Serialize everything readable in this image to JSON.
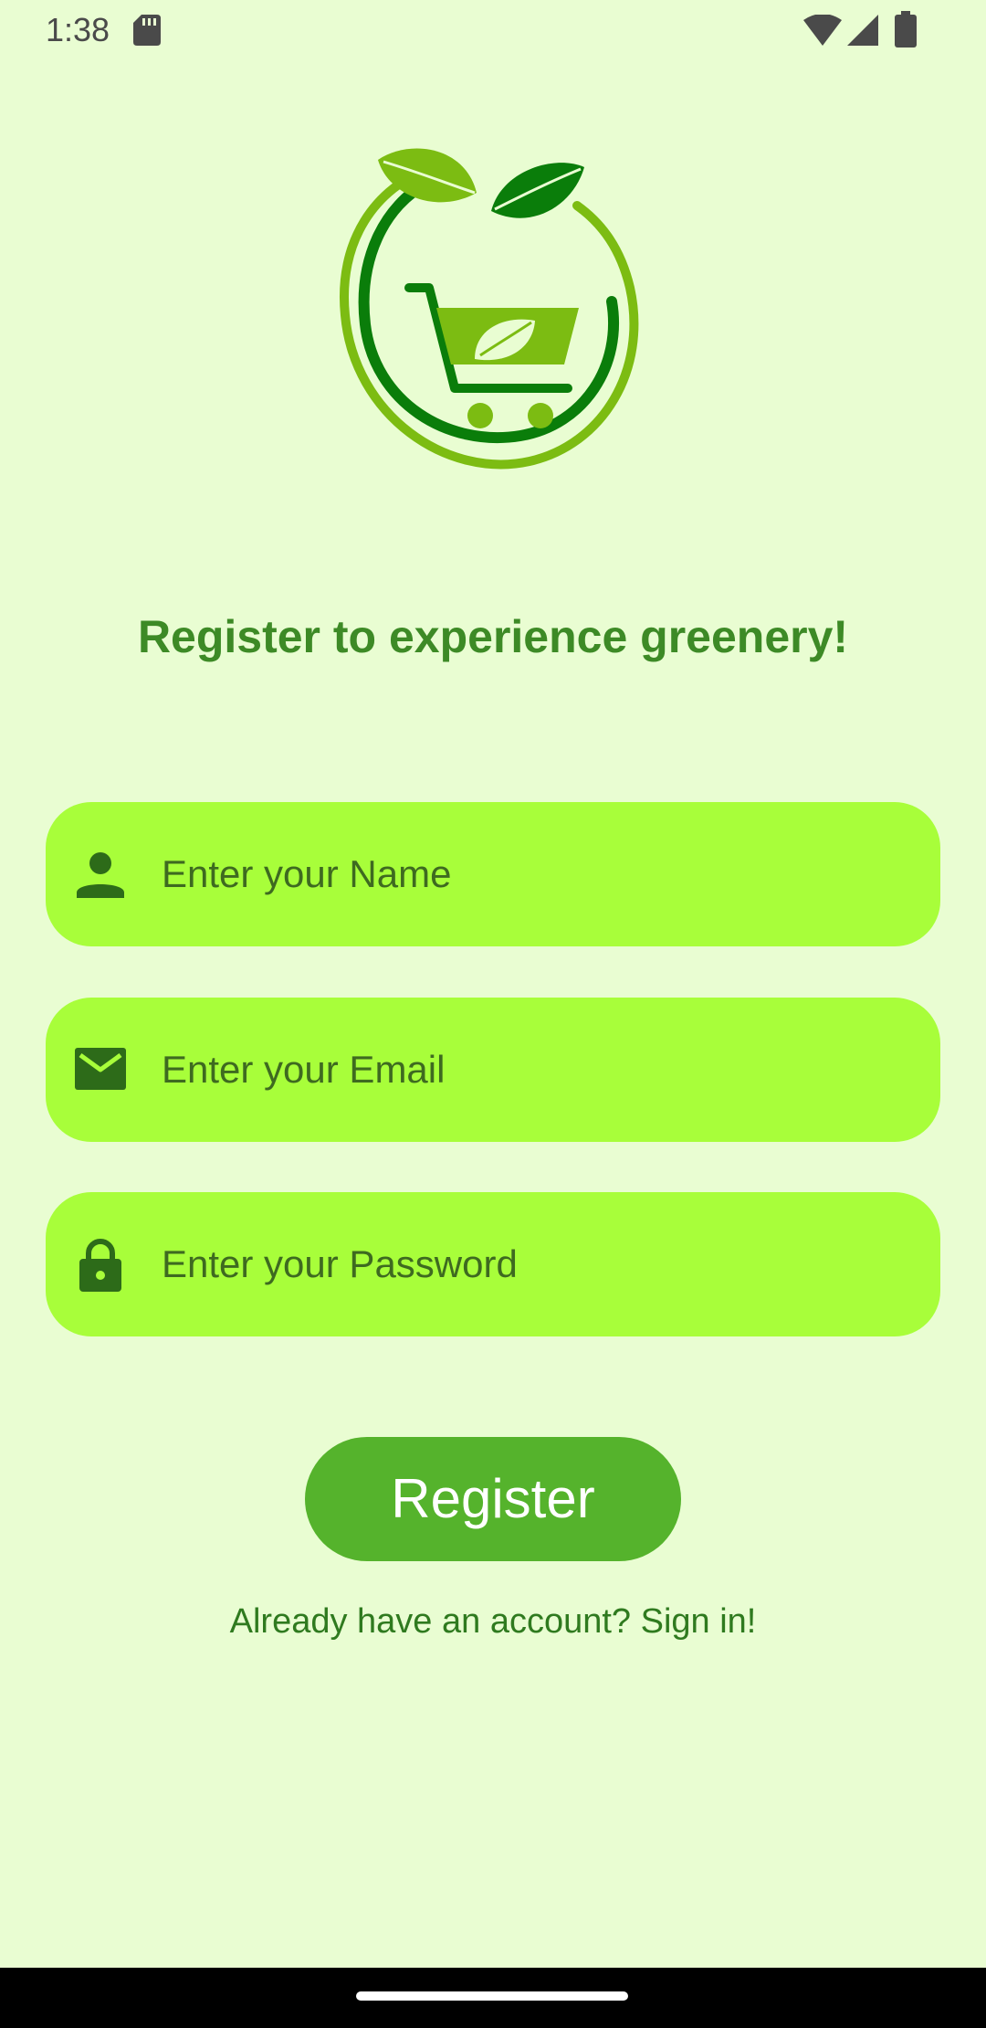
{
  "status_bar": {
    "time": "1:38",
    "icons": [
      "sd-card-icon",
      "wifi-icon",
      "cell-signal-icon",
      "battery-icon"
    ]
  },
  "logo": {
    "icon": "grocery-cart-leaf-logo",
    "colors": {
      "dark_green": "#0a7d0a",
      "light_green": "#7cbc12"
    }
  },
  "heading": "Register to experience greenery!",
  "form": {
    "name": {
      "icon": "person-icon",
      "placeholder": "Enter your Name"
    },
    "email": {
      "icon": "mail-icon",
      "placeholder": "Enter your Email"
    },
    "password": {
      "icon": "lock-icon",
      "placeholder": "Enter your Password"
    }
  },
  "register_button": "Register",
  "signin_link": "Already have an account? Sign in!",
  "colors": {
    "background": "#e9fdd2",
    "field_background": "#a8fe3a",
    "button_background": "#55b32c",
    "heading_text": "#3d8a26",
    "icon_green": "#2d6b19"
  }
}
